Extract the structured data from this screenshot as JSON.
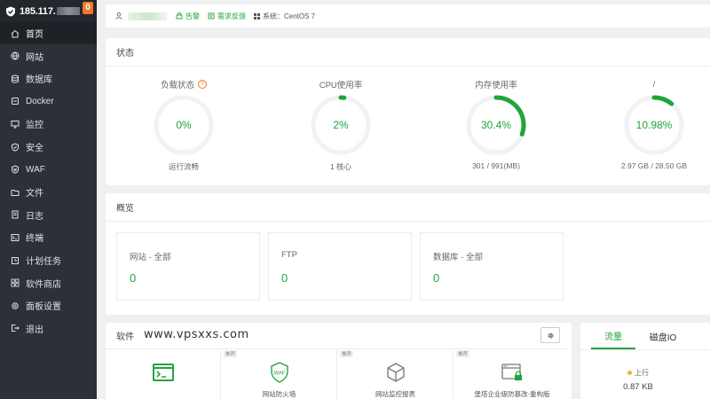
{
  "sidebar": {
    "ip": "185.117.",
    "badge": "0",
    "items": [
      {
        "label": "首页",
        "icon": "home-icon"
      },
      {
        "label": "网站",
        "icon": "globe-icon"
      },
      {
        "label": "数据库",
        "icon": "database-icon"
      },
      {
        "label": "Docker",
        "icon": "docker-icon"
      },
      {
        "label": "监控",
        "icon": "monitor-icon"
      },
      {
        "label": "安全",
        "icon": "shield-icon"
      },
      {
        "label": "WAF",
        "icon": "waf-shield-icon"
      },
      {
        "label": "文件",
        "icon": "folder-icon"
      },
      {
        "label": "日志",
        "icon": "log-icon"
      },
      {
        "label": "终端",
        "icon": "terminal-icon"
      },
      {
        "label": "计划任务",
        "icon": "clock-icon"
      },
      {
        "label": "软件商店",
        "icon": "apps-icon"
      },
      {
        "label": "面板设置",
        "icon": "settings-icon"
      },
      {
        "label": "退出",
        "icon": "logout-icon"
      }
    ]
  },
  "topbar": {
    "alert": "告警",
    "feedback": "需求反馈",
    "system": "系统：CentOS 7"
  },
  "status": {
    "title": "状态",
    "gauges": [
      {
        "label": "负载状态",
        "value": "0%",
        "sub": "运行流畅",
        "percent": 0,
        "help": "?"
      },
      {
        "label": "CPU使用率",
        "value": "2%",
        "sub": "1 核心",
        "percent": 2
      },
      {
        "label": "内存使用率",
        "value": "30.4%",
        "sub": "301 / 991(MB)",
        "percent": 30.4
      },
      {
        "label": "/",
        "value": "10.98%",
        "sub": "2.97 GB / 28.50 GB",
        "percent": 10.98
      }
    ]
  },
  "overview": {
    "title": "概览",
    "boxes": [
      {
        "label": "网站 - 全部",
        "value": "0"
      },
      {
        "label": "FTP",
        "value": "0"
      },
      {
        "label": "数据库 - 全部",
        "value": "0"
      }
    ]
  },
  "software": {
    "title": "软件",
    "watermark": "www.vpsxxs.com",
    "items": [
      {
        "name": "",
        "tag": "",
        "icon": "terminal-app-icon"
      },
      {
        "name": "网站防火墙",
        "tag": "推荐",
        "icon": "waf-icon"
      },
      {
        "name": "网站监控报表",
        "tag": "推荐",
        "icon": "cube-icon"
      },
      {
        "name": "堡塔企业级防篡改-重构版",
        "tag": "推荐",
        "icon": "browser-lock-icon"
      }
    ]
  },
  "traffic": {
    "tabs": [
      "流量",
      "磁盘IO"
    ],
    "up_label": "上行",
    "up_value": "0.87 KB"
  },
  "colors": {
    "accent": "#20a53a",
    "warn": "#f0762b",
    "sidebar": "#2c3138"
  }
}
